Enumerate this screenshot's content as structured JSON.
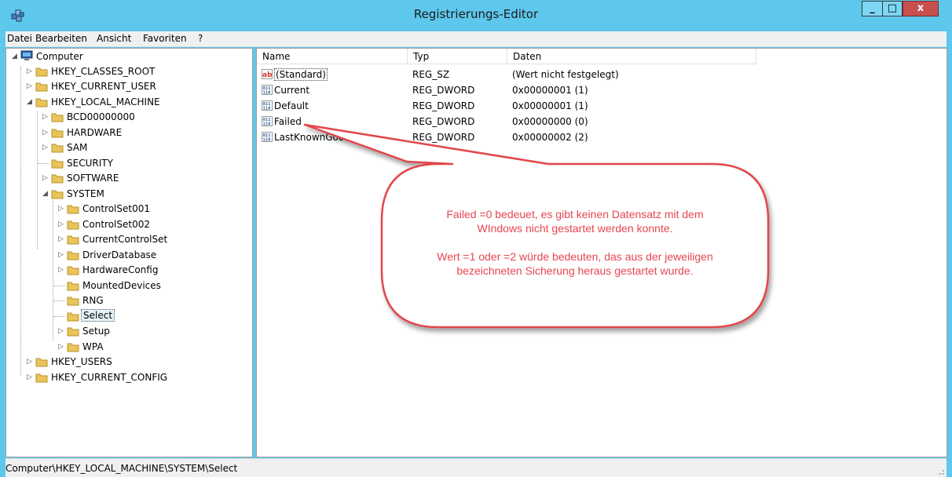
{
  "window": {
    "title": "Registrierungs-Editor",
    "min_glyph": "_",
    "max_glyph": "□",
    "close_glyph": "x"
  },
  "menu": [
    "Datei",
    "Bearbeiten",
    "Ansicht",
    "Favoriten",
    "?"
  ],
  "tree": {
    "root": "Computer",
    "hkcr": "HKEY_CLASSES_ROOT",
    "hkcu": "HKEY_CURRENT_USER",
    "hklm": "HKEY_LOCAL_MACHINE",
    "bcd": "BCD00000000",
    "hardware": "HARDWARE",
    "sam": "SAM",
    "security": "SECURITY",
    "software": "SOFTWARE",
    "system": "SYSTEM",
    "cs001": "ControlSet001",
    "cs002": "ControlSet002",
    "ccs": "CurrentControlSet",
    "driverdb": "DriverDatabase",
    "hwconfig": "HardwareConfig",
    "mounted": "MountedDevices",
    "rng": "RNG",
    "select": "Select",
    "setup": "Setup",
    "wpa": "WPA",
    "hku": "HKEY_USERS",
    "hkcc": "HKEY_CURRENT_CONFIG"
  },
  "columns": {
    "name": "Name",
    "type": "Typ",
    "data": "Daten"
  },
  "values": [
    {
      "name": "(Standard)",
      "type": "REG_SZ",
      "data": "(Wert nicht festgelegt)",
      "icon": "string-value-icon"
    },
    {
      "name": "Current",
      "type": "REG_DWORD",
      "data": "0x00000001 (1)",
      "icon": "dword-value-icon"
    },
    {
      "name": "Default",
      "type": "REG_DWORD",
      "data": "0x00000001 (1)",
      "icon": "dword-value-icon"
    },
    {
      "name": "Failed",
      "type": "REG_DWORD",
      "data": "0x00000000 (0)",
      "icon": "dword-value-icon"
    },
    {
      "name": "LastKnownGood",
      "type": "REG_DWORD",
      "data": "0x00000002 (2)",
      "icon": "dword-value-icon"
    }
  ],
  "callout": {
    "line1": "Failed =0 bedeuet, es gibt keinen Datensatz mit dem",
    "line2": "WIndows nicht gestartet werden konnte.",
    "line3": "Wert =1 oder =2 würde bedeuten, das aus der jeweiligen",
    "line4": "bezeichneten Sicherung heraus gestartet wurde.",
    "color": "#e64650"
  },
  "status": {
    "path": "Computer\\HKEY_LOCAL_MACHINE\\SYSTEM\\Select"
  },
  "colors": {
    "titlebar": "#5ec7ec",
    "close_button": "#c7504f",
    "selection": "#e5f3fb",
    "folder": "#e8c45a"
  }
}
